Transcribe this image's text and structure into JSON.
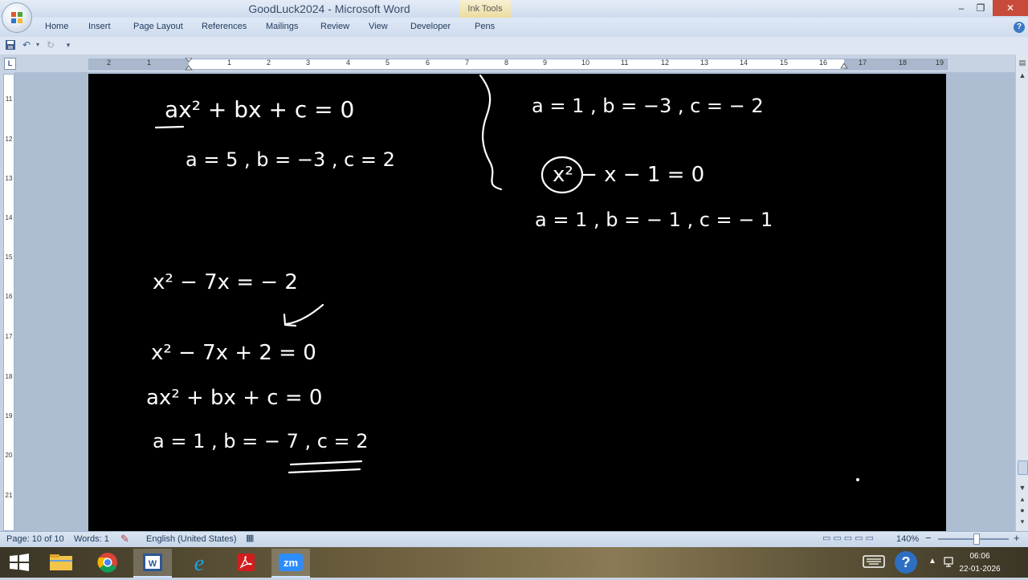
{
  "window": {
    "title": "GoodLuck2024 - Microsoft Word",
    "contextual_tab": "Ink Tools",
    "minimize": "–",
    "restore": "❐",
    "close": "✕"
  },
  "ribbon": {
    "tabs": [
      "Home",
      "Insert",
      "Page Layout",
      "References",
      "Mailings",
      "Review",
      "View",
      "Developer",
      "Pens"
    ],
    "help": "?"
  },
  "ruler": {
    "toggle": "L",
    "h_numbers": [
      "2",
      "1",
      "1",
      "2",
      "3",
      "4",
      "5",
      "6",
      "7",
      "8",
      "9",
      "10",
      "11",
      "12",
      "13",
      "14",
      "15",
      "16",
      "17",
      "18",
      "19"
    ],
    "v_numbers": [
      "11",
      "12",
      "13",
      "14",
      "15",
      "16",
      "17",
      "18",
      "19",
      "20",
      "21"
    ]
  },
  "document": {
    "math": {
      "eq1": "ax² + bx + c = 0",
      "eq1_coeffs": "a = 5 ,  b = −3 ,  c = 2",
      "eq2": "x² − 7x = − 2",
      "eq3": "x² − 7x + 2 = 0",
      "eq4": "ax² + bx + c = 0",
      "eq4_coeffs": "a = 1 ,  b = − 7 ,  c = 2",
      "right_coeffs1": "a = 1 ,  b = −3 ,  c = − 2",
      "eq5": "x² − x − 1 = 0",
      "right_coeffs2": "a = 1 ,  b = − 1 ,  c = − 1"
    }
  },
  "status": {
    "page": "Page: 10 of 10",
    "words": "Words: 1",
    "language": "English (United States)",
    "zoom": "140%",
    "zoom_minus": "−",
    "zoom_plus": "+"
  },
  "taskbar": {
    "items": [
      "start-icon",
      "file-explorer-icon",
      "chrome-icon",
      "word-icon",
      "ie-icon",
      "acrobat-icon",
      "zoom-icon"
    ],
    "zoom_label": "zm",
    "time": "06:06",
    "date": "22-01-2026"
  }
}
